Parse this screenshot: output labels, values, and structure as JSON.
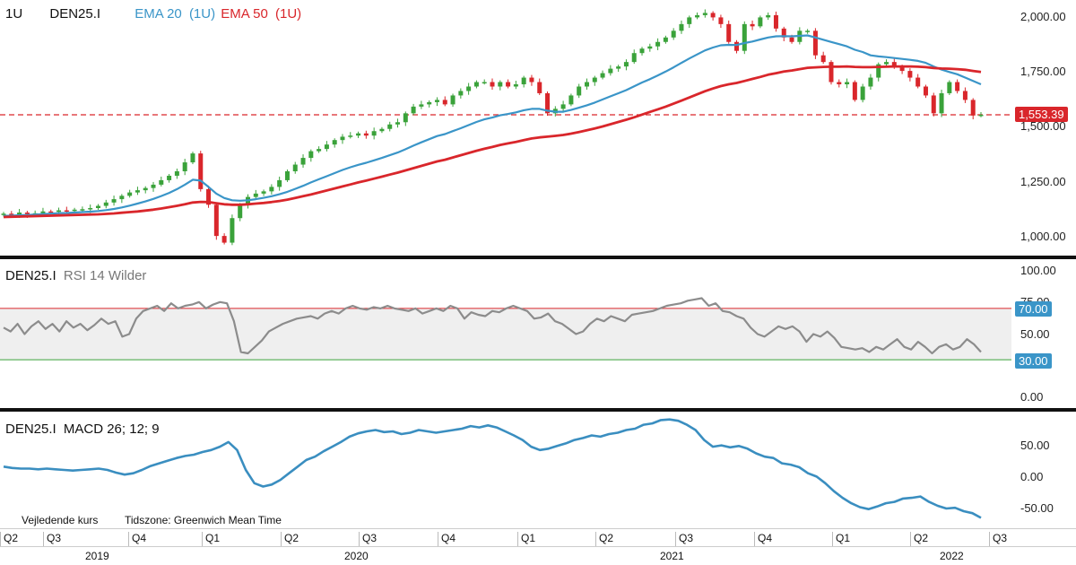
{
  "price_panel": {
    "interval": "1U",
    "symbol": "DEN25.I",
    "ema20_label": "EMA 20",
    "ema20_interval": "(1U)",
    "ema50_label": "EMA 50",
    "ema50_interval": "(1U)",
    "current_price": "1,553.39",
    "y_ticks": [
      "2,000.00",
      "1,750.00",
      "1,500.00",
      "1,250.00",
      "1,000.00"
    ]
  },
  "rsi_panel": {
    "symbol": "DEN25.I",
    "label": "RSI 14 Wilder",
    "upper_level": "70.00",
    "lower_level": "30.00",
    "y_ticks": [
      "100.00",
      "75.00",
      "50.00",
      "0.00"
    ]
  },
  "macd_panel": {
    "symbol": "DEN25.I",
    "label": "MACD 26; 12; 9",
    "y_ticks": [
      "50.00",
      "0.00",
      "-50.00"
    ]
  },
  "footer": {
    "price_note": "Vejledende kurs",
    "timezone": "Tidszone: Greenwich Mean Time"
  },
  "x_axis": {
    "quarters": [
      "Q2",
      "Q3",
      "Q4",
      "Q1",
      "Q2",
      "Q3",
      "Q4",
      "Q1",
      "Q2",
      "Q3",
      "Q4",
      "Q1",
      "Q2",
      "Q3"
    ],
    "years": [
      "2019",
      "2020",
      "2021",
      "2022"
    ]
  },
  "colors": {
    "ema20": "#3a95c8",
    "ema50": "#d9262b",
    "up_candle": "#3aa23a",
    "down_candle": "#d9262b",
    "rsi_line": "#8c8c8c",
    "rsi_upper": "#d9262b",
    "rsi_lower": "#3aa23a",
    "rsi_tag": "#3a95c8",
    "macd_line": "#3a8ec0",
    "price_tag": "#d9262b"
  },
  "chart_data": [
    {
      "type": "candlestick",
      "title": "DEN25.I",
      "ylim": [
        930,
        2060
      ],
      "series": [
        {
          "name": "DEN25.I",
          "close": [
            1110,
            1105,
            1115,
            1108,
            1112,
            1120,
            1118,
            1125,
            1122,
            1128,
            1130,
            1135,
            1145,
            1160,
            1175,
            1190,
            1205,
            1215,
            1225,
            1240,
            1260,
            1280,
            1300,
            1340,
            1380,
            1220,
            1150,
            1010,
            980,
            1090,
            1150,
            1185,
            1200,
            1210,
            1230,
            1260,
            1300,
            1330,
            1360,
            1390,
            1400,
            1420,
            1440,
            1455,
            1460,
            1470,
            1460,
            1480,
            1490,
            1510,
            1520,
            1560,
            1590,
            1600,
            1610,
            1620,
            1600,
            1640,
            1660,
            1680,
            1700,
            1700,
            1680,
            1700,
            1680,
            1690,
            1720,
            1700,
            1650,
            1560,
            1580,
            1600,
            1640,
            1680,
            1700,
            1720,
            1740,
            1760,
            1770,
            1790,
            1830,
            1850,
            1860,
            1880,
            1900,
            1930,
            1960,
            1990,
            2000,
            2010,
            1990,
            1960,
            1880,
            1840,
            1960,
            1950,
            1990,
            2000,
            1940,
            1900,
            1880,
            1930,
            1930,
            1820,
            1790,
            1700,
            1690,
            1700,
            1620,
            1680,
            1720,
            1780,
            1790,
            1770,
            1750,
            1720,
            1680,
            1640,
            1560,
            1650,
            1700,
            1660,
            1620,
            1550,
            1553.39
          ]
        },
        {
          "name": "EMA 20",
          "values": [
            1100,
            1101,
            1103,
            1104,
            1106,
            1108,
            1110,
            1112,
            1113,
            1115,
            1117,
            1119,
            1122,
            1126,
            1131,
            1138,
            1146,
            1155,
            1165,
            1176,
            1189,
            1203,
            1220,
            1240,
            1262,
            1258,
            1230,
            1200,
            1180,
            1170,
            1168,
            1170,
            1175,
            1181,
            1188,
            1197,
            1208,
            1221,
            1235,
            1250,
            1264,
            1278,
            1292,
            1306,
            1318,
            1329,
            1338,
            1349,
            1360,
            1372,
            1384,
            1399,
            1415,
            1430,
            1444,
            1458,
            1467,
            1480,
            1493,
            1507,
            1521,
            1533,
            1541,
            1551,
            1557,
            1564,
            1574,
            1580,
            1580,
            1572,
            1567,
            1567,
            1575,
            1585,
            1596,
            1608,
            1622,
            1636,
            1650,
            1664,
            1681,
            1698,
            1713,
            1730,
            1747,
            1766,
            1786,
            1806,
            1824,
            1842,
            1855,
            1865,
            1867,
            1866,
            1875,
            1882,
            1891,
            1900,
            1905,
            1906,
            1905,
            1907,
            1909,
            1900,
            1890,
            1880,
            1870,
            1860,
            1845,
            1835,
            1820,
            1815,
            1812,
            1808,
            1804,
            1800,
            1795,
            1786,
            1770,
            1756,
            1745,
            1735,
            1720,
            1705,
            1690
          ]
        },
        {
          "name": "EMA 50",
          "values": [
            1095,
            1096,
            1097,
            1098,
            1099,
            1100,
            1101,
            1102,
            1103,
            1104,
            1105,
            1106,
            1107,
            1109,
            1111,
            1114,
            1117,
            1120,
            1124,
            1128,
            1133,
            1139,
            1145,
            1152,
            1160,
            1163,
            1162,
            1157,
            1152,
            1150,
            1150,
            1152,
            1155,
            1158,
            1162,
            1167,
            1173,
            1180,
            1188,
            1196,
            1205,
            1214,
            1223,
            1232,
            1241,
            1250,
            1258,
            1267,
            1276,
            1285,
            1294,
            1304,
            1314,
            1324,
            1334,
            1344,
            1352,
            1362,
            1372,
            1382,
            1392,
            1401,
            1409,
            1418,
            1425,
            1432,
            1440,
            1447,
            1452,
            1455,
            1459,
            1463,
            1469,
            1476,
            1484,
            1492,
            1501,
            1511,
            1521,
            1531,
            1542,
            1554,
            1566,
            1578,
            1590,
            1603,
            1617,
            1631,
            1645,
            1659,
            1671,
            1682,
            1690,
            1696,
            1705,
            1714,
            1723,
            1733,
            1740,
            1747,
            1752,
            1758,
            1764,
            1766,
            1768,
            1769,
            1769,
            1770,
            1768,
            1767,
            1767,
            1768,
            1769,
            1770,
            1770,
            1770,
            1769,
            1767,
            1763,
            1761,
            1760,
            1758,
            1755,
            1750,
            1745
          ]
        }
      ]
    },
    {
      "type": "line",
      "title": "RSI 14 Wilder",
      "ylim": [
        0,
        100
      ],
      "levels": [
        70,
        30
      ],
      "series": [
        {
          "name": "RSI 14 Wilder",
          "values": [
            55,
            52,
            58,
            50,
            56,
            60,
            54,
            58,
            52,
            60,
            55,
            58,
            53,
            57,
            62,
            58,
            60,
            48,
            50,
            62,
            68,
            70,
            72,
            68,
            74,
            70,
            72,
            73,
            75,
            70,
            73,
            75,
            74,
            60,
            36,
            35,
            40,
            45,
            52,
            55,
            58,
            60,
            62,
            63,
            64,
            62,
            66,
            68,
            66,
            70,
            72,
            70,
            69,
            71,
            70,
            72,
            70,
            69,
            68,
            70,
            66,
            68,
            70,
            68,
            72,
            70,
            62,
            67,
            65,
            64,
            68,
            67,
            70,
            72,
            70,
            68,
            62,
            63,
            66,
            60,
            58,
            54,
            50,
            52,
            58,
            62,
            60,
            64,
            62,
            60,
            65,
            66,
            67,
            68,
            70,
            72,
            73,
            74,
            76,
            77,
            78,
            72,
            74,
            68,
            67,
            64,
            62,
            55,
            50,
            48,
            52,
            56,
            54,
            56,
            52,
            44,
            50,
            48,
            52,
            47,
            40,
            39,
            38,
            39,
            36,
            40,
            38,
            42,
            46,
            40,
            38,
            44,
            40,
            35,
            40,
            42,
            38,
            40,
            46,
            42,
            36
          ]
        }
      ]
    },
    {
      "type": "line",
      "title": "MACD 26; 12; 9",
      "ylim": [
        -75,
        95
      ],
      "series": [
        {
          "name": "MACD 26; 12; 9",
          "values": [
            15,
            13,
            12,
            12,
            11,
            12,
            11,
            10,
            9,
            10,
            11,
            12,
            10,
            6,
            3,
            5,
            10,
            16,
            20,
            24,
            28,
            31,
            33,
            37,
            40,
            45,
            52,
            40,
            10,
            -10,
            -15,
            -12,
            -5,
            5,
            15,
            25,
            30,
            38,
            45,
            52,
            60,
            65,
            68,
            70,
            67,
            68,
            64,
            66,
            70,
            68,
            66,
            68,
            70,
            72,
            76,
            74,
            77,
            74,
            68,
            62,
            55,
            45,
            40,
            42,
            46,
            50,
            55,
            58,
            62,
            60,
            64,
            66,
            70,
            72,
            78,
            80,
            85,
            86,
            84,
            78,
            70,
            55,
            45,
            47,
            44,
            46,
            42,
            35,
            30,
            28,
            20,
            18,
            14,
            5,
            0,
            -10,
            -22,
            -32,
            -40,
            -46,
            -49,
            -45,
            -40,
            -38,
            -33,
            -32,
            -30,
            -38,
            -44,
            -48,
            -47,
            -52,
            -55,
            -62
          ]
        }
      ]
    }
  ]
}
